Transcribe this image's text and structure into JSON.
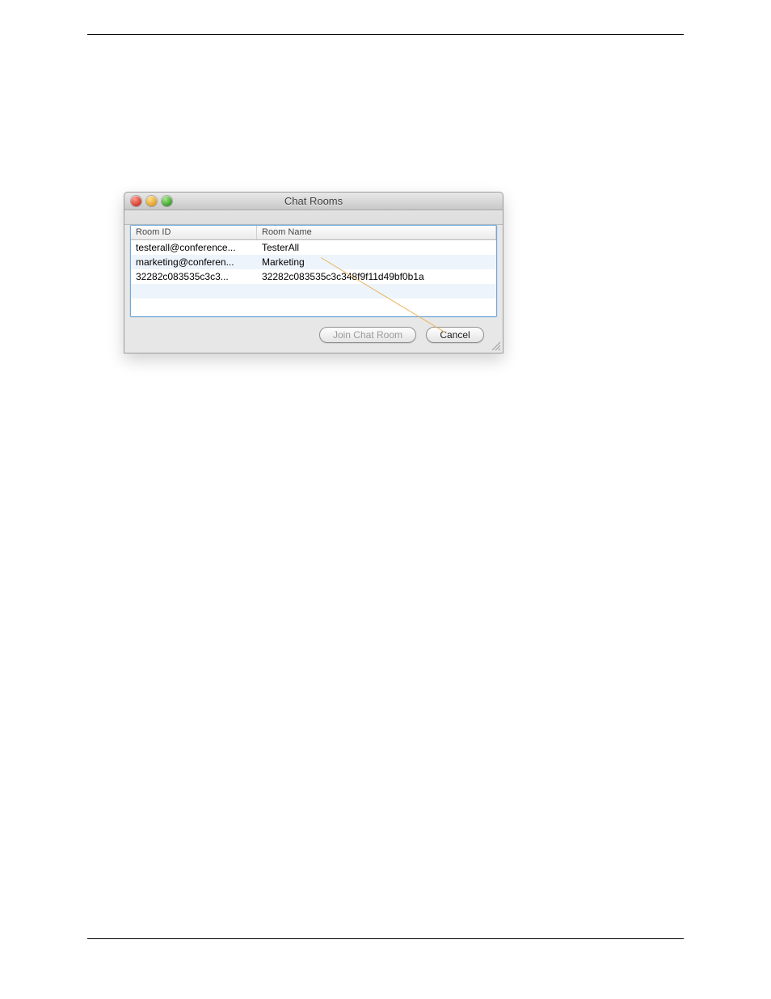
{
  "window": {
    "title": "Chat Rooms"
  },
  "table": {
    "headers": {
      "room_id": "Room ID",
      "room_name": "Room Name"
    },
    "rows": [
      {
        "id": "testerall@conference...",
        "name": "TesterAll"
      },
      {
        "id": "marketing@conferen...",
        "name": "Marketing"
      },
      {
        "id": "32282c083535c3c3...",
        "name": "32282c083535c3c348f9f11d49bf0b1a"
      }
    ]
  },
  "buttons": {
    "join": "Join Chat Room",
    "cancel": "Cancel"
  }
}
